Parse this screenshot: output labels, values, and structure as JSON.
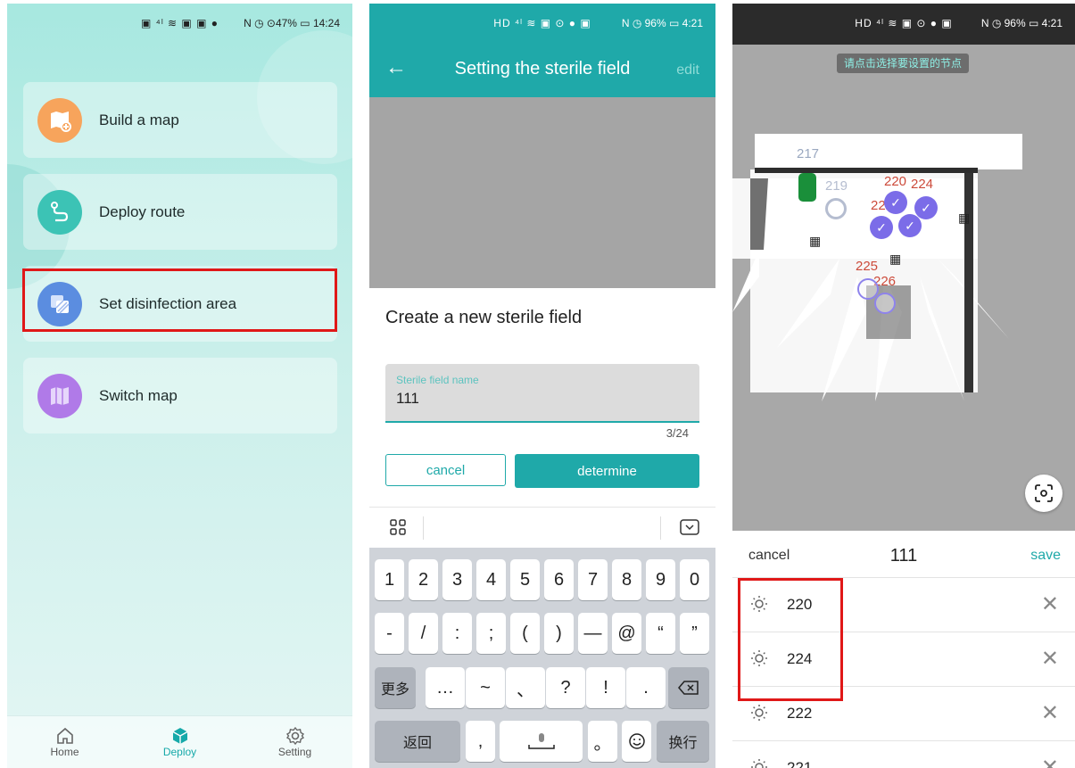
{
  "screen1": {
    "status": {
      "icons": "▣ ⁴ˡ ≋ ▣ ▣ ●",
      "right": "N ◷ ⊙47% ▭ 14:24"
    },
    "menu": [
      {
        "label": "Build a map",
        "icon": "map-plus-icon",
        "color": "#f7a45c"
      },
      {
        "label": "Deploy route",
        "icon": "route-icon",
        "color": "#3cc3b5"
      },
      {
        "label": "Set disinfection area",
        "icon": "disinfection-area-icon",
        "color": "#5b8de0"
      },
      {
        "label": "Switch map",
        "icon": "switch-map-icon",
        "color": "#b07ae8"
      }
    ],
    "tabs": [
      {
        "label": "Home",
        "icon": "home-icon"
      },
      {
        "label": "Deploy",
        "icon": "cube-icon"
      },
      {
        "label": "Setting",
        "icon": "gear-icon"
      }
    ],
    "active_tab": "Deploy"
  },
  "screen2": {
    "status": {
      "icons": "HD ⁴ˡ ≋ ▣ ⊙ ● ▣",
      "right": "N ◷ 96% ▭ 4:21"
    },
    "title": "Setting the sterile field",
    "edit": "edit",
    "dialog": {
      "title": "Create a new sterile field",
      "field_label": "Sterile field name",
      "field_value": "111",
      "counter": "3/24",
      "cancel": "cancel",
      "determine": "determine"
    },
    "keyboard": {
      "row1": [
        "1",
        "2",
        "3",
        "4",
        "5",
        "6",
        "7",
        "8",
        "9",
        "0"
      ],
      "row2": [
        "-",
        "/",
        ":",
        ";",
        "(",
        ")",
        "—",
        "@",
        "“",
        "”"
      ],
      "row3": [
        "更多",
        "…",
        "~",
        "、",
        "?",
        "!",
        "."
      ],
      "row4": {
        "left": "返回",
        "comma": ",",
        "dot": "。",
        "right": "换行"
      }
    }
  },
  "screen3": {
    "status": {
      "icons": "HD ⁴ˡ ≋ ▣ ⊙ ● ▣",
      "right": "N ◷ 96% ▭ 4:21"
    },
    "hint": "请点击选择要设置的节点",
    "nodes": [
      {
        "label": "217",
        "color": "#9aa8c0"
      },
      {
        "label": "219",
        "color": "#b5bdd0"
      },
      {
        "label": "220",
        "color": "#cc4a3a"
      },
      {
        "label": "224",
        "color": "#cc4a3a"
      },
      {
        "label": "222",
        "color": "#cc4a3a"
      },
      {
        "label": "225",
        "color": "#cc4a3a"
      },
      {
        "label": "226",
        "color": "#cc4a3a"
      }
    ],
    "header": {
      "cancel": "cancel",
      "title": "111",
      "save": "save"
    },
    "rows": [
      "220",
      "224",
      "222",
      "221"
    ]
  }
}
